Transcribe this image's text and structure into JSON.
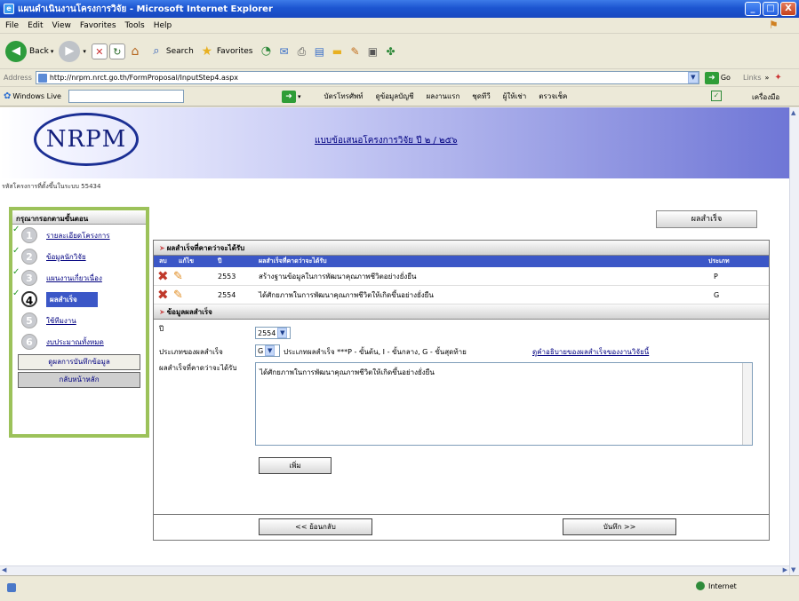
{
  "window": {
    "title": "แผนดำเนินงานโครงการวิจัย - Microsoft Internet Explorer",
    "buttons": {
      "minimize": "_",
      "maximize": "□",
      "close": "X"
    }
  },
  "menu": [
    "File",
    "Edit",
    "View",
    "Favorites",
    "Tools",
    "Help"
  ],
  "toolbar": {
    "back": "Back",
    "search": "Search",
    "favorites": "Favorites"
  },
  "address": {
    "label": "Address",
    "url": "http://nrpm.nrct.go.th/FormProposal/InputStep4.aspx",
    "go": "Go",
    "links": "Links"
  },
  "livebar": {
    "brand": "Windows Live",
    "links": [
      "บัตรโทรศัพท์",
      "ดูข้อมูลบัญชี",
      "ผลงานแรก",
      "ชุดทีวี",
      "ผู้ให้เช่า",
      "ตรวจเช็ค"
    ],
    "tools": "เครื่องมือ"
  },
  "page": {
    "logo": "NRPM",
    "heading": "แบบข้อเสนอโครงการวิจัย ปี ๒ / ๒๕๖",
    "project_code": "รหัสโครงการที่ตั้งขึ้นในระบบ 55434",
    "tab_button": "ผลสำเร็จ",
    "sidebar": {
      "title": "กรุณากรอกตามขั้นตอน",
      "steps": [
        {
          "num": "1",
          "label": "รายละเอียดโครงการ",
          "done": true
        },
        {
          "num": "2",
          "label": "ข้อมูลนักวิจัย",
          "done": true
        },
        {
          "num": "3",
          "label": "แผนงานเกี่ยวเนื่อง",
          "done": true
        },
        {
          "num": "4",
          "label": "ผลสำเร็จ",
          "done": true,
          "current": true
        },
        {
          "num": "5",
          "label": "ใช้ทีมงาน",
          "done": false
        },
        {
          "num": "6",
          "label": "งบประมาณทั้งหมด",
          "done": false
        }
      ],
      "btn_view": "ดูผลการบันทึกข้อมูล",
      "btn_home": "กลับหน้าหลัก"
    },
    "results": {
      "section_title": "ผลสำเร็จที่คาดว่าจะได้รับ",
      "columns": [
        "ลบ",
        "แก้ไข",
        "ปี",
        "ผลสำเร็จที่คาดว่าจะได้รับ",
        "ประเภท"
      ],
      "rows": [
        {
          "year": "2553",
          "text": "สร้างฐานข้อมูลในการพัฒนาคุณภาพชีวิตอย่างยั่งยืน",
          "type": "P"
        },
        {
          "year": "2554",
          "text": "ได้ศักยภาพในการพัฒนาคุณภาพชีวิตให้เกิดขึ้นอย่างยั่งยืน",
          "type": "G"
        }
      ]
    },
    "form": {
      "section_title": "ข้อมูลผลสำเร็จ",
      "year_label": "ปี",
      "year_value": "2554",
      "type_label": "ประเภทของผลสำเร็จ",
      "type_value": "G",
      "type_hint": "ประเภทผลสำเร็จ ***P - ขั้นต้น, I - ขั้นกลาง, G - ขั้นสุดท้าย",
      "type_link": "ดูคำอธิบายของผลสำเร็จของงานวิจัยนี้",
      "desc_label": "ผลสำเร็จที่คาดว่าจะได้รับ",
      "desc_value": "ได้ศักยภาพในการพัฒนาคุณภาพชีวิตให้เกิดขึ้นอย่างยั่งยืน",
      "add_button": "เพิ่ม"
    },
    "nav": {
      "back": "<< ย้อนกลับ",
      "save": "บันทึก >>"
    }
  },
  "status": {
    "zone": "Internet"
  }
}
